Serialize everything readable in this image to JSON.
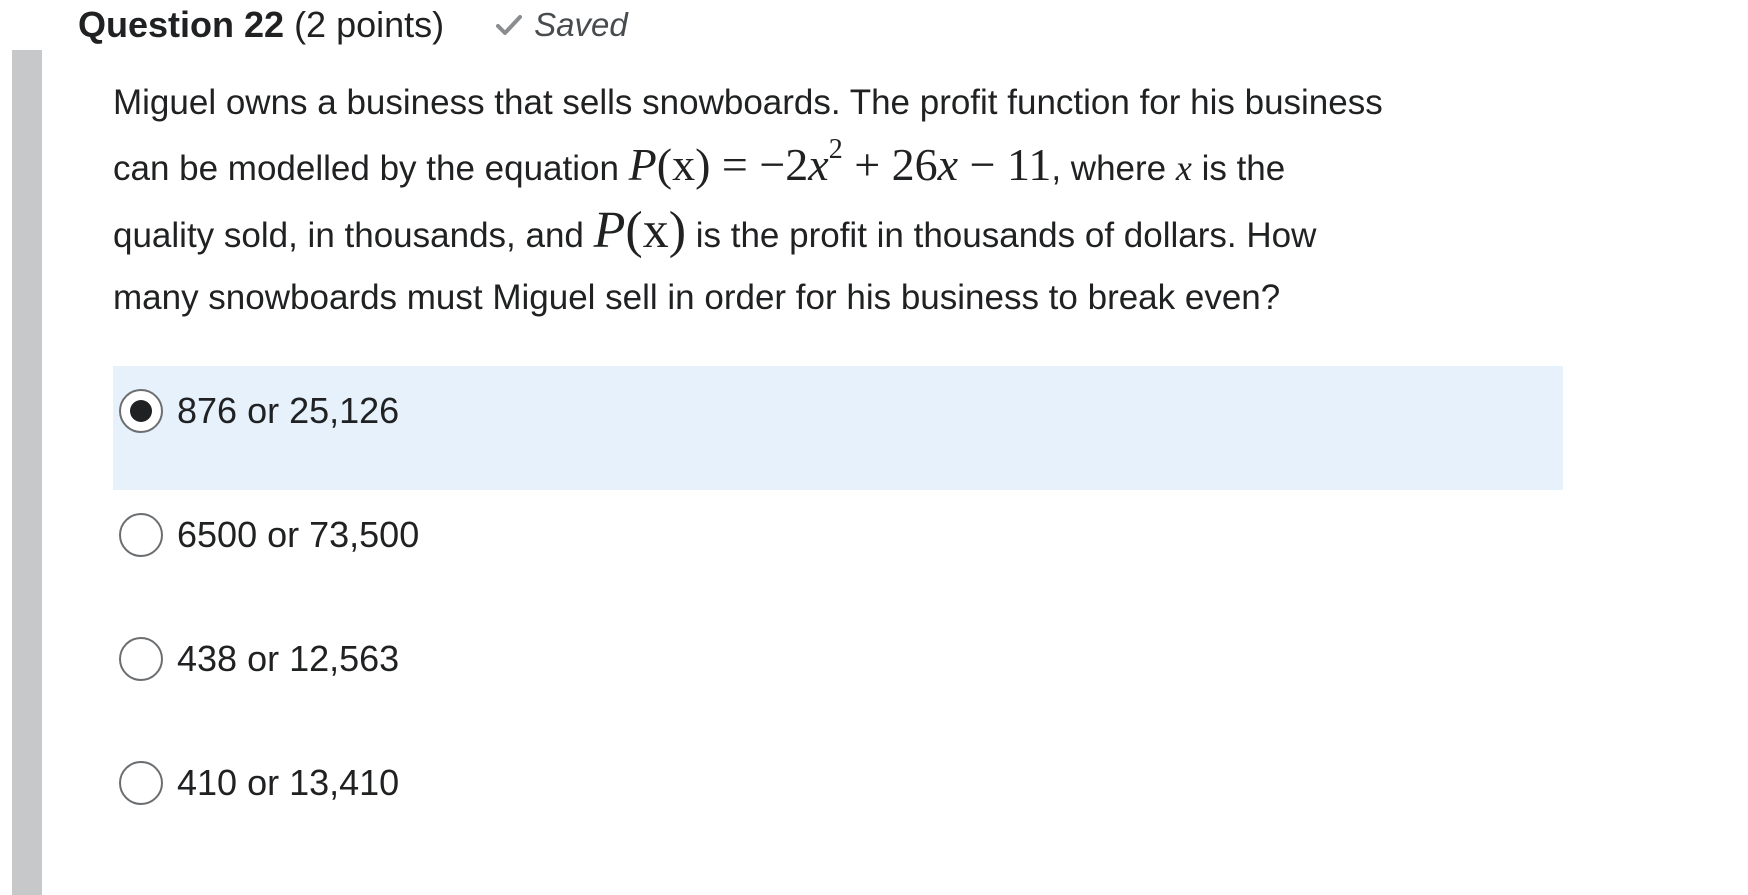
{
  "question": {
    "title": "Question 22",
    "points": "(2 points)",
    "status": "Saved",
    "text": {
      "line1": "Miguel owns a business that sells snowboards.  The profit function for his business",
      "line2_before": "can be modelled by the equation ",
      "equation_lhs": "P",
      "equation_paren": "(x)",
      "equation_rhs_a": " = −2",
      "equation_var": "x",
      "equation_exp": "2",
      "equation_rhs_b": " + 26",
      "equation_var2": "x",
      "equation_rhs_c": " − 11",
      "equation_comma": ",",
      "line2_after_a": " where ",
      "line2_var": "x",
      "line2_after_b": " is the",
      "line3_before": "quality sold, in thousands, and ",
      "px_p": "P",
      "px_paren": "(x)",
      "line3_after": " is the profit in thousands of dollars.  How",
      "line4": "many snowboards must Miguel sell in order for his business to break even?"
    }
  },
  "options": [
    {
      "label": "876 or 25,126",
      "selected": true
    },
    {
      "label": "6500 or 73,500",
      "selected": false
    },
    {
      "label": "438 or 12,563",
      "selected": false
    },
    {
      "label": "410 or 13,410",
      "selected": false
    }
  ],
  "colors": {
    "selected_background": "#e6f1fc",
    "left_bar": "#c6c8ca"
  },
  "icons": {
    "saved": "checkmark-icon"
  }
}
